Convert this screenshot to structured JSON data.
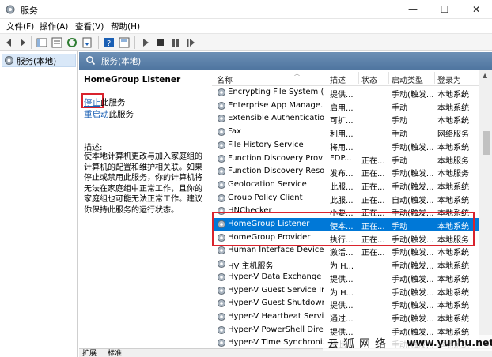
{
  "window": {
    "title": "服务",
    "min_glyph": "—",
    "max_glyph": "☐",
    "close_glyph": "✕"
  },
  "menu": [
    "文件(F)",
    "操作(A)",
    "查看(V)",
    "帮助(H)"
  ],
  "toolbar": {
    "icons": [
      "back-icon",
      "forward-icon",
      "console-tree-icon",
      "properties-icon",
      "refresh-icon",
      "export-icon",
      "help-icon",
      "view-icon",
      "play-icon",
      "stop-icon",
      "pause-icon",
      "restart-icon"
    ]
  },
  "tree": {
    "root_label": "服务(本地)"
  },
  "pane_header": {
    "title": "服务(本地)"
  },
  "details": {
    "service_name": "HomeGroup Listener",
    "stop_link": "停止",
    "stop_suffix": "此服务",
    "restart_link": "重启动",
    "restart_suffix": "此服务",
    "desc_label": "描述:",
    "desc_text": "使本地计算机更改与加入家庭组的计算机的配置和维护相关联。如果停止或禁用此服务，你的计算机将无法在家庭组中正常工作，且你的家庭组也可能无法正常工作。建议你保持此服务的运行状态。"
  },
  "columns": [
    "名称",
    "描述",
    "状态",
    "启动类型",
    "登录为"
  ],
  "rows": [
    {
      "name": "Encrypting File System (E...",
      "desc": "提供...",
      "status": "",
      "startup": "手动(触发...",
      "logon": "本地系统"
    },
    {
      "name": "Enterprise App Manage...",
      "desc": "启用...",
      "status": "",
      "startup": "手动",
      "logon": "本地系统"
    },
    {
      "name": "Extensible Authentication...",
      "desc": "可扩...",
      "status": "",
      "startup": "手动",
      "logon": "本地系统"
    },
    {
      "name": "Fax",
      "desc": "利用...",
      "status": "",
      "startup": "手动",
      "logon": "网络服务"
    },
    {
      "name": "File History Service",
      "desc": "将用...",
      "status": "",
      "startup": "手动(触发...",
      "logon": "本地系统"
    },
    {
      "name": "Function Discovery Provi...",
      "desc": "FDP...",
      "status": "正在...",
      "startup": "手动",
      "logon": "本地服务"
    },
    {
      "name": "Function Discovery Reso...",
      "desc": "发布...",
      "status": "正在...",
      "startup": "手动(触发...",
      "logon": "本地服务"
    },
    {
      "name": "Geolocation Service",
      "desc": "此服...",
      "status": "正在...",
      "startup": "手动(触发...",
      "logon": "本地系统"
    },
    {
      "name": "Group Policy Client",
      "desc": "此服...",
      "status": "正在...",
      "startup": "自动(触发...",
      "logon": "本地系统"
    },
    {
      "name": "HNChecker",
      "desc": "小要...",
      "status": "正在...",
      "startup": "手动(触发...",
      "logon": "本地系统"
    },
    {
      "name": "HomeGroup Listener",
      "desc": "使本...",
      "status": "正在...",
      "startup": "手动",
      "logon": "本地系统"
    },
    {
      "name": "HomeGroup Provider",
      "desc": "执行...",
      "status": "正在...",
      "startup": "手动(触发...",
      "logon": "本地服务"
    },
    {
      "name": "Human Interface Device ...",
      "desc": "激活...",
      "status": "正在...",
      "startup": "手动(触发...",
      "logon": "本地系统"
    },
    {
      "name": "HV 主机服务",
      "desc": "为 H...",
      "status": "",
      "startup": "手动(触发...",
      "logon": "本地系统"
    },
    {
      "name": "Hyper-V Data Exchange ...",
      "desc": "提供...",
      "status": "",
      "startup": "手动(触发...",
      "logon": "本地系统"
    },
    {
      "name": "Hyper-V Guest Service In...",
      "desc": "为 H...",
      "status": "",
      "startup": "手动(触发...",
      "logon": "本地系统"
    },
    {
      "name": "Hyper-V Guest Shutdown...",
      "desc": "提供...",
      "status": "",
      "startup": "手动(触发...",
      "logon": "本地系统"
    },
    {
      "name": "Hyper-V Heartbeat Service",
      "desc": "通过...",
      "status": "",
      "startup": "手动(触发...",
      "logon": "本地系统"
    },
    {
      "name": "Hyper-V PowerShell Direc...",
      "desc": "提供...",
      "status": "",
      "startup": "手动(触发...",
      "logon": "本地系统"
    },
    {
      "name": "Hyper-V Time Synchroniz...",
      "desc": "将此...",
      "status": "",
      "startup": "手动(触发...",
      "logon": "本地系统"
    }
  ],
  "selected_index": 10,
  "tabs": [
    "扩展",
    "标准"
  ],
  "watermark": {
    "cn": "云狐网络",
    "url": "www.yunhu.net"
  },
  "colors": {
    "selection": "#0078d7",
    "highlight_box": "#d9232d",
    "link": "#1a5fb4"
  }
}
